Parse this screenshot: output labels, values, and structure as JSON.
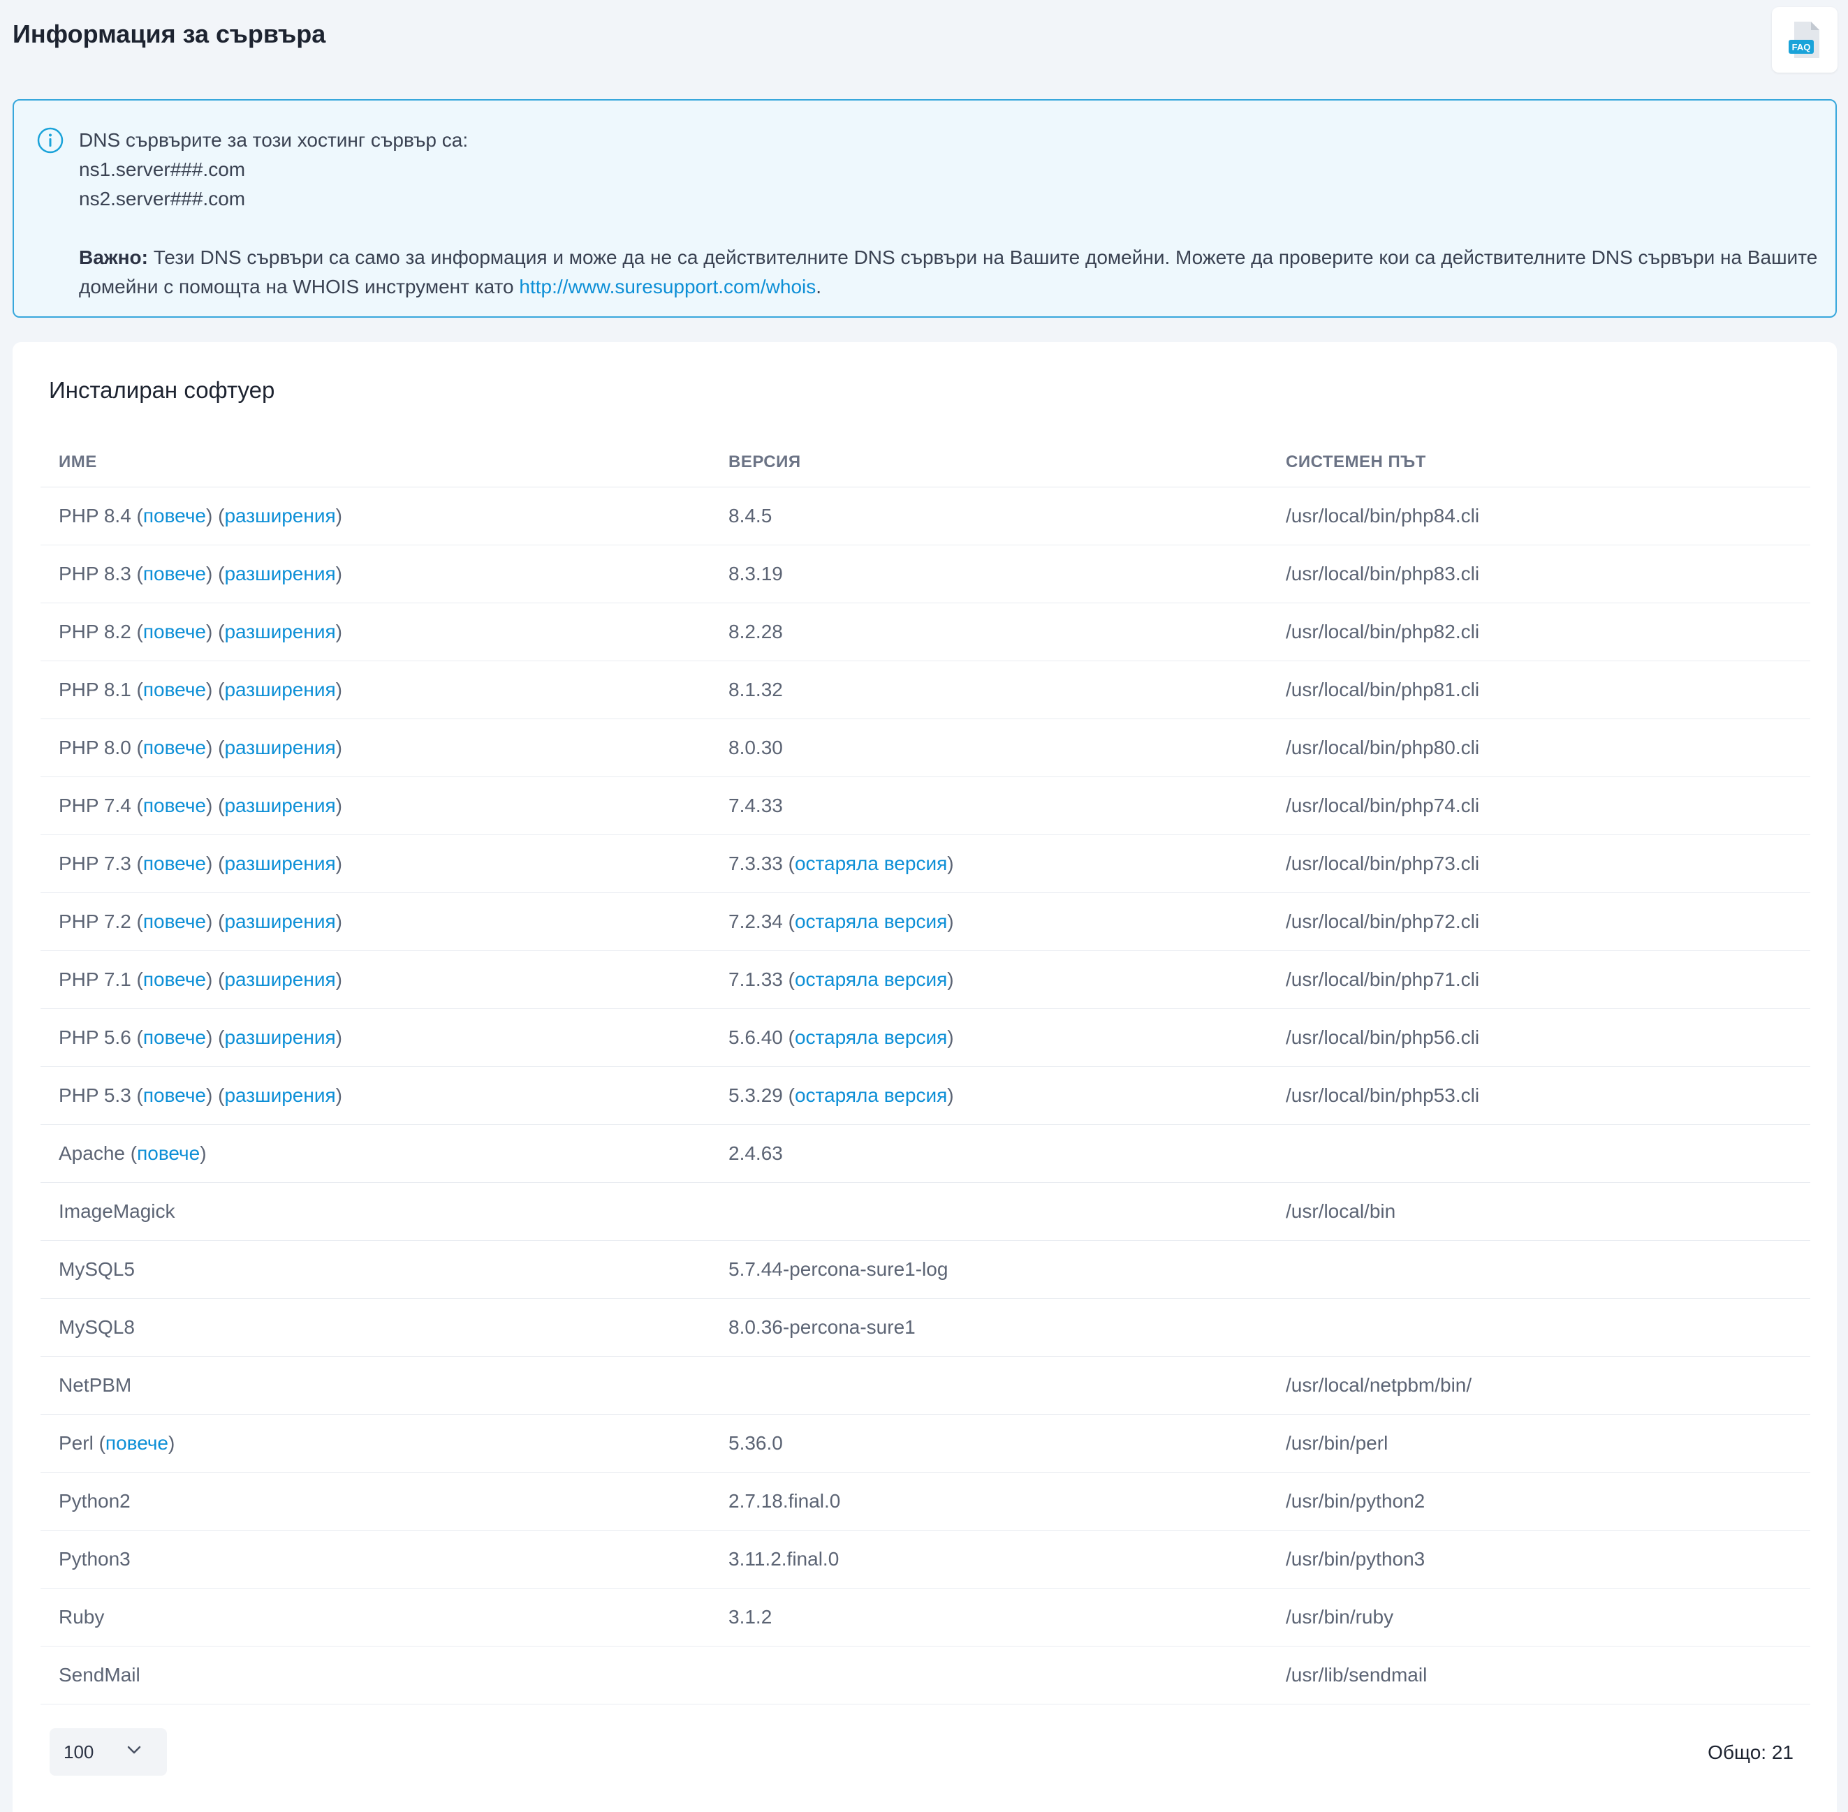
{
  "page": {
    "title": "Информация за сървъра"
  },
  "faq": {
    "label": "FAQ"
  },
  "info": {
    "line1": "DNS сървърите за този хостинг сървър са:",
    "ns1": "ns1.server###.com",
    "ns2": "ns2.server###.com",
    "important_label": "Важно:",
    "important_text": " Тези DNS сървъри са само за информация и може да не са действителните DNS сървъри на Вашите домейни. Можете да проверите кои са действителните DNS сървъри на Вашите домейни с помощта на WHOIS инструмент като ",
    "link": "http://www.suresupport.com/whois",
    "end": "."
  },
  "software": {
    "title": "Инсталиран софтуер",
    "columns": [
      "ИМЕ",
      "ВЕРСИЯ",
      "СИСТЕМЕН ПЪТ"
    ],
    "rows": [
      {
        "name": "PHP 8.4",
        "more": "повече",
        "ext": "разширения",
        "version": "8.4.5",
        "note": "",
        "path": "/usr/local/bin/php84.cli"
      },
      {
        "name": "PHP 8.3",
        "more": "повече",
        "ext": "разширения",
        "version": "8.3.19",
        "note": "",
        "path": "/usr/local/bin/php83.cli"
      },
      {
        "name": "PHP 8.2",
        "more": "повече",
        "ext": "разширения",
        "version": "8.2.28",
        "note": "",
        "path": "/usr/local/bin/php82.cli"
      },
      {
        "name": "PHP 8.1",
        "more": "повече",
        "ext": "разширения",
        "version": "8.1.32",
        "note": "",
        "path": "/usr/local/bin/php81.cli"
      },
      {
        "name": "PHP 8.0",
        "more": "повече",
        "ext": "разширения",
        "version": "8.0.30",
        "note": "",
        "path": "/usr/local/bin/php80.cli"
      },
      {
        "name": "PHP 7.4",
        "more": "повече",
        "ext": "разширения",
        "version": "7.4.33",
        "note": "",
        "path": "/usr/local/bin/php74.cli"
      },
      {
        "name": "PHP 7.3",
        "more": "повече",
        "ext": "разширения",
        "version": "7.3.33",
        "note": "остаряла версия",
        "path": "/usr/local/bin/php73.cli"
      },
      {
        "name": "PHP 7.2",
        "more": "повече",
        "ext": "разширения",
        "version": "7.2.34",
        "note": "остаряла версия",
        "path": "/usr/local/bin/php72.cli"
      },
      {
        "name": "PHP 7.1",
        "more": "повече",
        "ext": "разширения",
        "version": "7.1.33",
        "note": "остаряла версия",
        "path": "/usr/local/bin/php71.cli"
      },
      {
        "name": "PHP 5.6",
        "more": "повече",
        "ext": "разширения",
        "version": "5.6.40",
        "note": "остаряла версия",
        "path": "/usr/local/bin/php56.cli"
      },
      {
        "name": "PHP 5.3",
        "more": "повече",
        "ext": "разширения",
        "version": "5.3.29",
        "note": "остаряла версия",
        "path": "/usr/local/bin/php53.cli"
      },
      {
        "name": "Apache",
        "more": "повече",
        "ext": "",
        "version": "2.4.63",
        "note": "",
        "path": ""
      },
      {
        "name": "ImageMagick",
        "more": "",
        "ext": "",
        "version": "",
        "note": "",
        "path": "/usr/local/bin"
      },
      {
        "name": "MySQL5",
        "more": "",
        "ext": "",
        "version": "5.7.44-percona-sure1-log",
        "note": "",
        "path": ""
      },
      {
        "name": "MySQL8",
        "more": "",
        "ext": "",
        "version": "8.0.36-percona-sure1",
        "note": "",
        "path": ""
      },
      {
        "name": "NetPBM",
        "more": "",
        "ext": "",
        "version": "",
        "note": "",
        "path": "/usr/local/netpbm/bin/"
      },
      {
        "name": "Perl",
        "more": "повече",
        "ext": "",
        "version": "5.36.0",
        "note": "",
        "path": "/usr/bin/perl"
      },
      {
        "name": "Python2",
        "more": "",
        "ext": "",
        "version": "2.7.18.final.0",
        "note": "",
        "path": "/usr/bin/python2"
      },
      {
        "name": "Python3",
        "more": "",
        "ext": "",
        "version": "3.11.2.final.0",
        "note": "",
        "path": "/usr/bin/python3"
      },
      {
        "name": "Ruby",
        "more": "",
        "ext": "",
        "version": "3.1.2",
        "note": "",
        "path": "/usr/bin/ruby"
      },
      {
        "name": "SendMail",
        "more": "",
        "ext": "",
        "version": "",
        "note": "",
        "path": "/usr/lib/sendmail"
      }
    ]
  },
  "footer": {
    "page_size": "100",
    "total": "Общо: 21"
  },
  "colors": {
    "accent": "#0d8fd6",
    "info_border": "#37a7dc",
    "info_bg": "#eef8fd"
  }
}
